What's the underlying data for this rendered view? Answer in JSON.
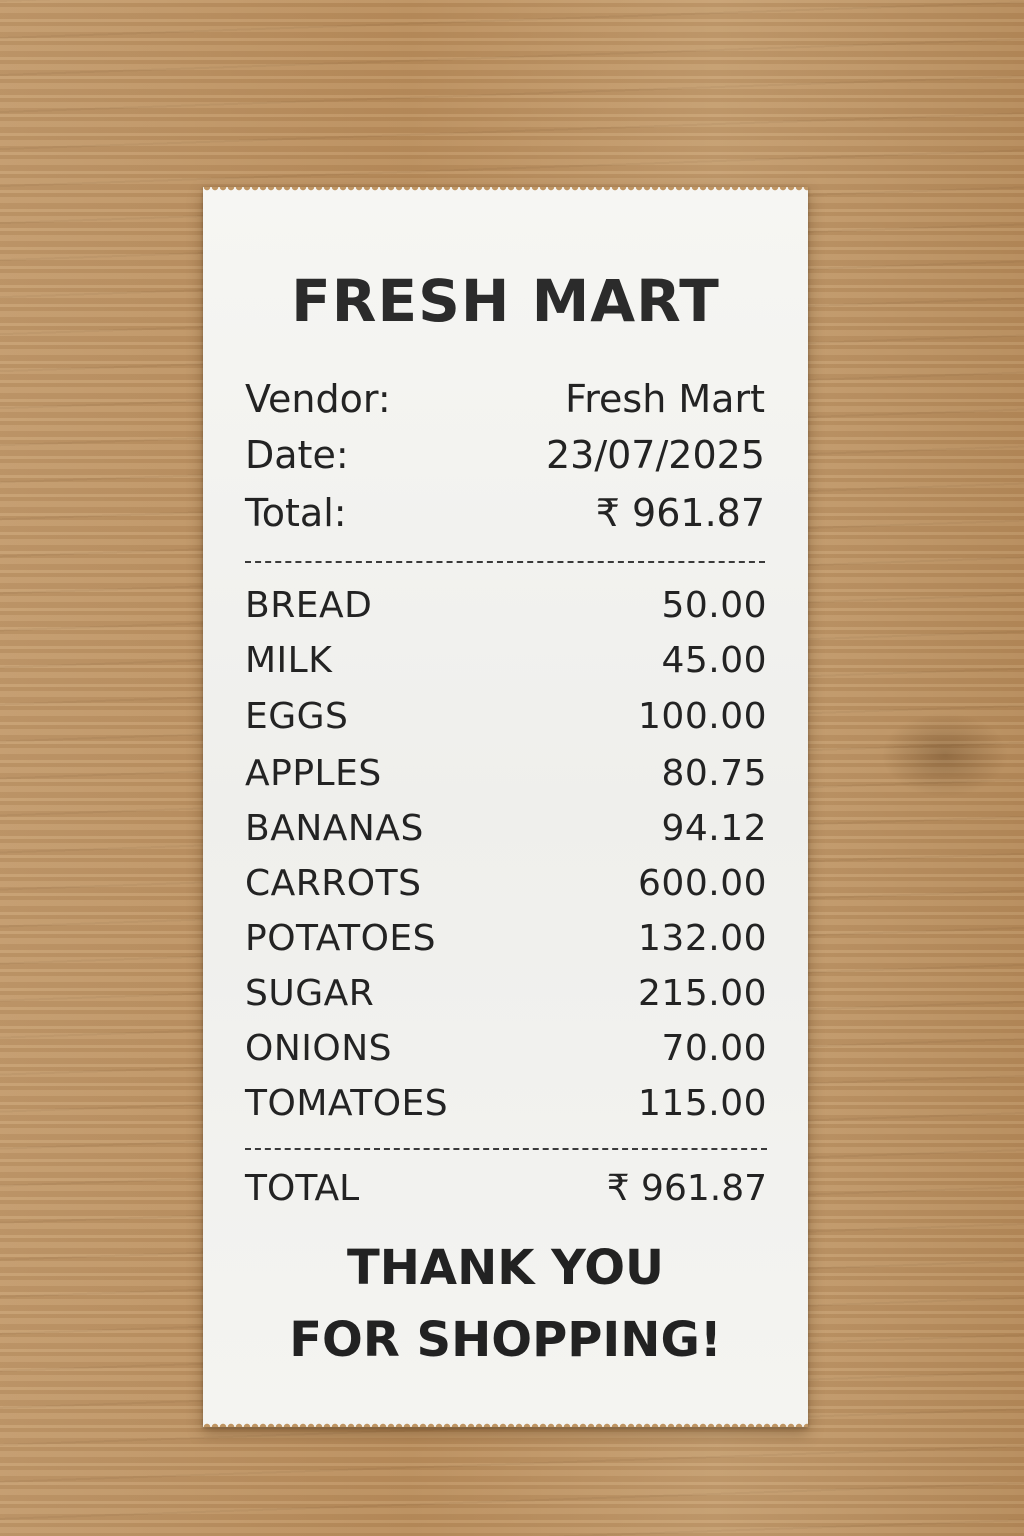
{
  "receipt": {
    "store_name": "FRESH MART",
    "header": [
      {
        "label": "Vendor:",
        "value": "Fresh Mart"
      },
      {
        "label": "Date:",
        "value": "23/07/2025"
      },
      {
        "label": "Total:",
        "value": "₹ 961.87"
      }
    ],
    "items": [
      {
        "name": "BREAD",
        "price": "50.00"
      },
      {
        "name": "MILK",
        "price": "45.00"
      },
      {
        "name": "EGGS",
        "price": "100.00"
      },
      {
        "name": "APPLES",
        "price": "80.75"
      },
      {
        "name": "BANANAS",
        "price": "94.12"
      },
      {
        "name": "CARROTS",
        "price": "600.00"
      },
      {
        "name": "POTATOES",
        "price": "132.00"
      },
      {
        "name": "SUGAR",
        "price": "215.00"
      },
      {
        "name": "ONIONS",
        "price": "70.00"
      },
      {
        "name": "TOMATOES",
        "price": "115.00"
      }
    ],
    "total": {
      "label": "TOTAL",
      "value": "₹ 961.87"
    },
    "thank_you": [
      "THANK YOU",
      "FOR SHOPPING!"
    ]
  }
}
